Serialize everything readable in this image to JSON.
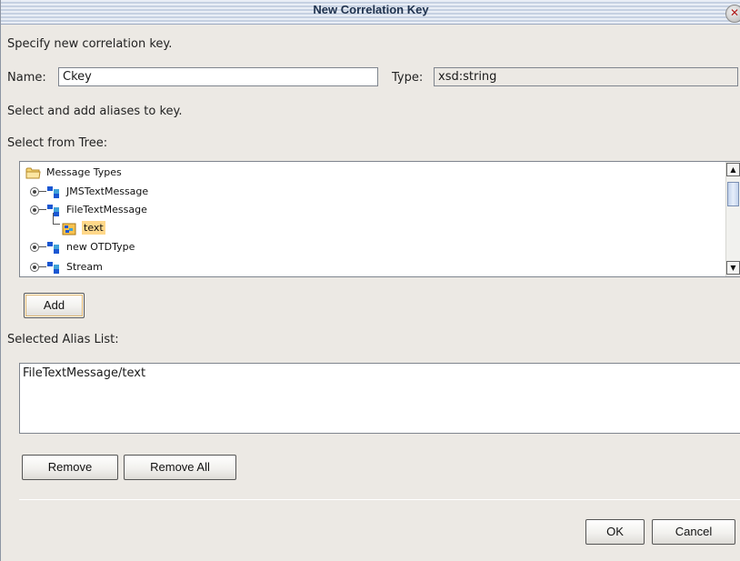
{
  "dialog": {
    "title": "New Correlation Key",
    "close_symbol": "✕",
    "instruction": "Specify new correlation key.",
    "name_label": "Name:",
    "name_value": "Ckey",
    "type_label": "Type:",
    "type_value": "xsd:string",
    "alias_instruction": "Select and add aliases to key.",
    "tree_label": "Select from Tree:",
    "tree": {
      "root": "Message Types",
      "items": [
        {
          "label": "JMSTextMessage",
          "icon": "otd-icon"
        },
        {
          "label": "FileTextMessage",
          "icon": "otd-icon"
        },
        {
          "label": "text",
          "icon": "field-element-icon",
          "selected": true
        },
        {
          "label": "new OTDType",
          "icon": "otd-icon"
        },
        {
          "label": "Stream",
          "icon": "otd-icon"
        }
      ]
    },
    "add_label": "Add",
    "alias_list_label": "Selected Alias List:",
    "aliases": [
      "FileTextMessage/text"
    ],
    "remove_label": "Remove",
    "remove_all_label": "Remove All",
    "ok_label": "OK",
    "cancel_label": "Cancel"
  },
  "colors": {
    "window_bg": "#ece9e4",
    "title_text": "#20334f",
    "selection_bg": "#ffd88a",
    "icon_blue": "#1b57d2"
  }
}
